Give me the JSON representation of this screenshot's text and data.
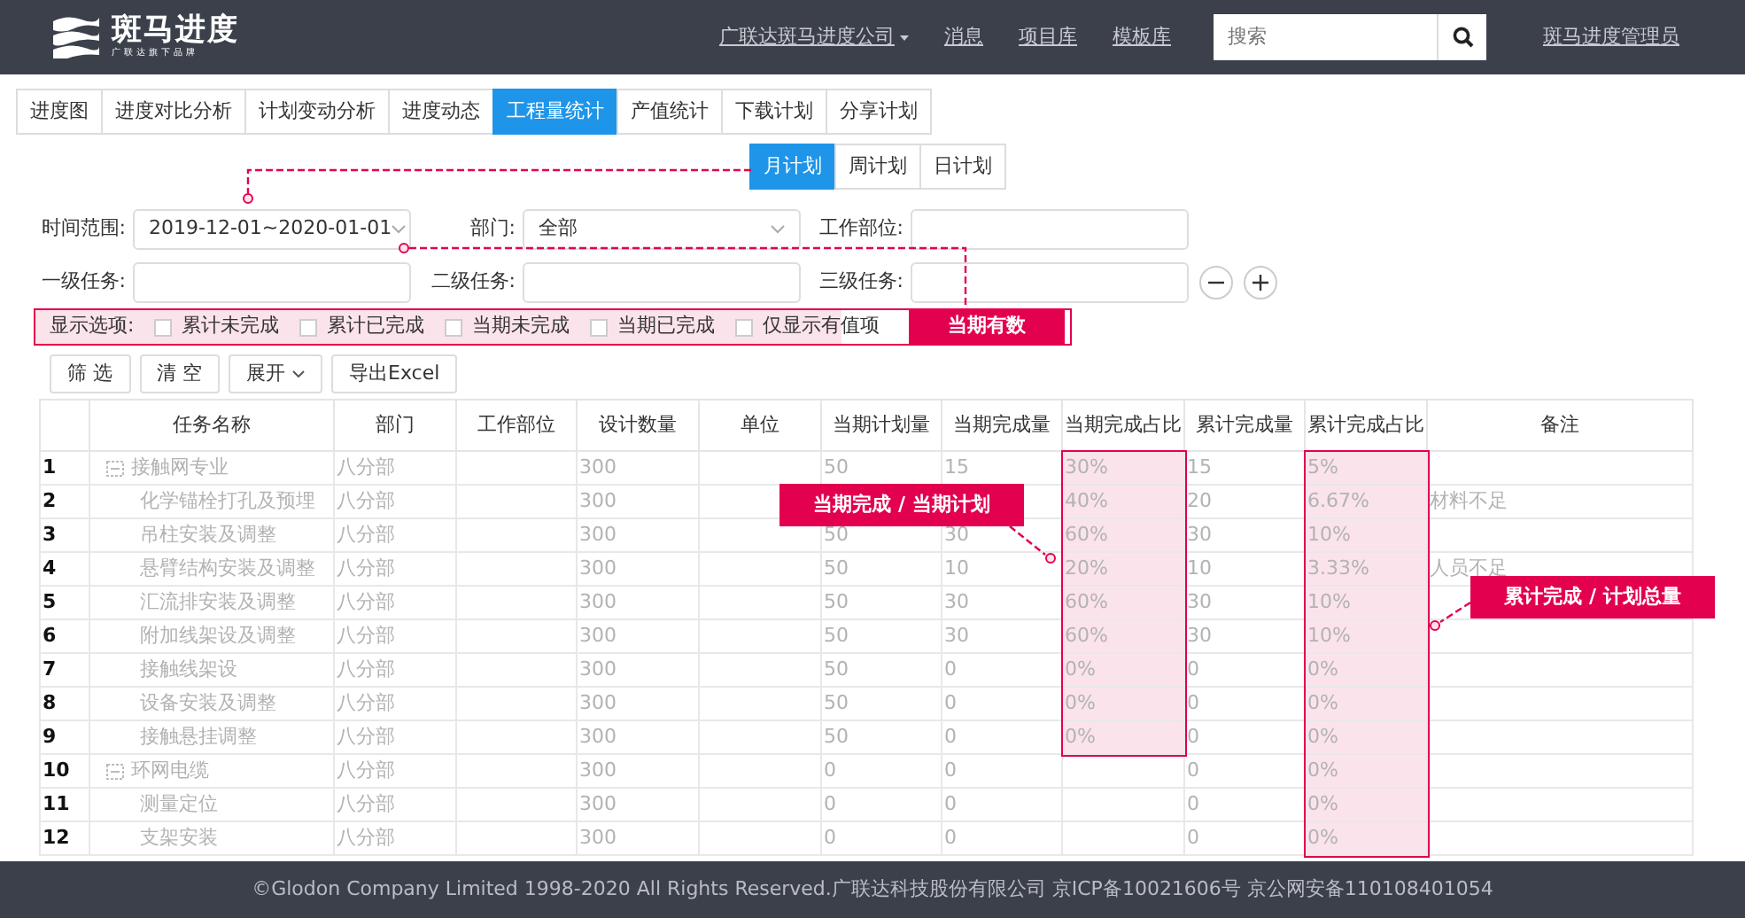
{
  "navbar": {
    "logo_title": "斑马进度",
    "logo_subtitle": "广联达旗下品牌",
    "company": "广联达斑马进度公司",
    "links": [
      "消息",
      "项目库",
      "模板库"
    ],
    "search": {
      "placeholder": "搜索"
    },
    "user": "斑马进度管理员"
  },
  "tabs": [
    {
      "label": "进度图",
      "selected": false
    },
    {
      "label": "进度对比分析",
      "selected": false
    },
    {
      "label": "计划变动分析",
      "selected": false
    },
    {
      "label": "进度动态",
      "selected": false
    },
    {
      "label": "工程量统计",
      "selected": true
    },
    {
      "label": "产值统计",
      "selected": false
    },
    {
      "label": "下载计划",
      "selected": false
    },
    {
      "label": "分享计划",
      "selected": false
    }
  ],
  "plan_tabs": [
    {
      "label": "月计划",
      "selected": true
    },
    {
      "label": "周计划",
      "selected": false
    },
    {
      "label": "日计划",
      "selected": false
    }
  ],
  "filters": [
    {
      "label": "时间范围:",
      "value": "2019-12-01~2020-01-01",
      "kind": "select"
    },
    {
      "label": "部门:",
      "value": "全部",
      "kind": "select"
    },
    {
      "label": "工作部位:",
      "kind": "text"
    },
    {
      "label": "一级任务:",
      "kind": "text"
    },
    {
      "label": "二级任务:",
      "kind": "text"
    },
    {
      "label": "三级任务:",
      "kind": "text"
    }
  ],
  "display_options": {
    "label": "显示选项:",
    "items": [
      {
        "label": "累计未完成",
        "checked": false
      },
      {
        "label": "累计已完成",
        "checked": false
      },
      {
        "label": "当期未完成",
        "checked": false
      },
      {
        "label": "当期已完成",
        "checked": false
      },
      {
        "label": "仅显示有值项",
        "checked": false
      }
    ],
    "tag": "当期有数"
  },
  "buttons": [
    "筛 选",
    "清 空",
    "展开",
    "导出Excel"
  ],
  "table": {
    "columns": [
      "任务名称",
      "部门",
      "工作部位",
      "设计数量",
      "单位",
      "当期计划量",
      "当期完成量",
      "当期完成占比",
      "累计完成量",
      "累计完成占比",
      "备注"
    ],
    "rows": [
      {
        "index": "1",
        "kind": "group",
        "expanded": true,
        "ratio_highlighted": true,
        "cum_ratio_highlighted": true,
        "cells": [
          "接触网专业",
          "八分部",
          null,
          "300",
          null,
          "50",
          "15",
          "30%",
          "15",
          "5%",
          null
        ]
      },
      {
        "index": "2",
        "kind": "task",
        "ratio_highlighted": true,
        "cum_ratio_highlighted": true,
        "cells": [
          "化学锚栓打孔及预埋",
          "八分部",
          null,
          "300",
          null,
          null,
          null,
          "40%",
          "20",
          "6.67%",
          "材料不足"
        ]
      },
      {
        "index": "3",
        "kind": "task",
        "ratio_highlighted": true,
        "cum_ratio_highlighted": true,
        "cells": [
          "吊柱安装及调整",
          "八分部",
          null,
          "300",
          null,
          "50",
          "30",
          "60%",
          "30",
          "10%",
          null
        ]
      },
      {
        "index": "4",
        "kind": "task",
        "ratio_highlighted": true,
        "cum_ratio_highlighted": true,
        "cells": [
          "悬臂结构安装及调整",
          "八分部",
          null,
          "300",
          null,
          "50",
          "10",
          "20%",
          "10",
          "3.33%",
          "人员不足"
        ]
      },
      {
        "index": "5",
        "kind": "task",
        "ratio_highlighted": true,
        "cum_ratio_highlighted": true,
        "cells": [
          "汇流排安装及调整",
          "八分部",
          null,
          "300",
          null,
          "50",
          "30",
          "60%",
          "30",
          "10%",
          null
        ]
      },
      {
        "index": "6",
        "kind": "task",
        "ratio_highlighted": true,
        "cum_ratio_highlighted": true,
        "cells": [
          "附加线架设及调整",
          "八分部",
          null,
          "300",
          null,
          "50",
          "30",
          "60%",
          "30",
          "10%",
          null
        ]
      },
      {
        "index": "7",
        "kind": "task",
        "ratio_highlighted": true,
        "cum_ratio_highlighted": true,
        "cells": [
          "接触线架设",
          "八分部",
          null,
          "300",
          null,
          "50",
          "0",
          "0%",
          "0",
          "0%",
          null
        ]
      },
      {
        "index": "8",
        "kind": "task",
        "ratio_highlighted": true,
        "cum_ratio_highlighted": true,
        "cells": [
          "设备安装及调整",
          "八分部",
          null,
          "300",
          null,
          "50",
          "0",
          "0%",
          "0",
          "0%",
          null
        ]
      },
      {
        "index": "9",
        "kind": "task",
        "ratio_highlighted": true,
        "cum_ratio_highlighted": true,
        "cells": [
          "接触悬挂调整",
          "八分部",
          null,
          "300",
          null,
          "50",
          "0",
          "0%",
          "0",
          "0%",
          null
        ]
      },
      {
        "index": "10",
        "kind": "group",
        "expanded": true,
        "ratio_highlighted": false,
        "cum_ratio_highlighted": true,
        "cells": [
          "环网电缆",
          "八分部",
          null,
          "300",
          null,
          "0",
          "0",
          null,
          "0",
          "0%",
          null
        ]
      },
      {
        "index": "11",
        "kind": "task",
        "ratio_highlighted": false,
        "cum_ratio_highlighted": true,
        "cells": [
          "测量定位",
          "八分部",
          null,
          "300",
          null,
          "0",
          "0",
          null,
          "0",
          "0%",
          null
        ]
      },
      {
        "index": "12",
        "kind": "task",
        "ratio_highlighted": false,
        "cum_ratio_highlighted": true,
        "cells": [
          "支架安装",
          "八分部",
          null,
          "300",
          null,
          "0",
          "0",
          null,
          "0",
          "0%",
          null
        ]
      }
    ]
  },
  "annotations": [
    {
      "text": "当期完成 / 当期计划"
    },
    {
      "text": "累计完成 / 计划总量"
    }
  ],
  "footer": "©Glodon Company Limited 1998-2020 All Rights Reserved.广联达科技股份有限公司 京ICP备10021606号 京公网安备110108401054"
}
